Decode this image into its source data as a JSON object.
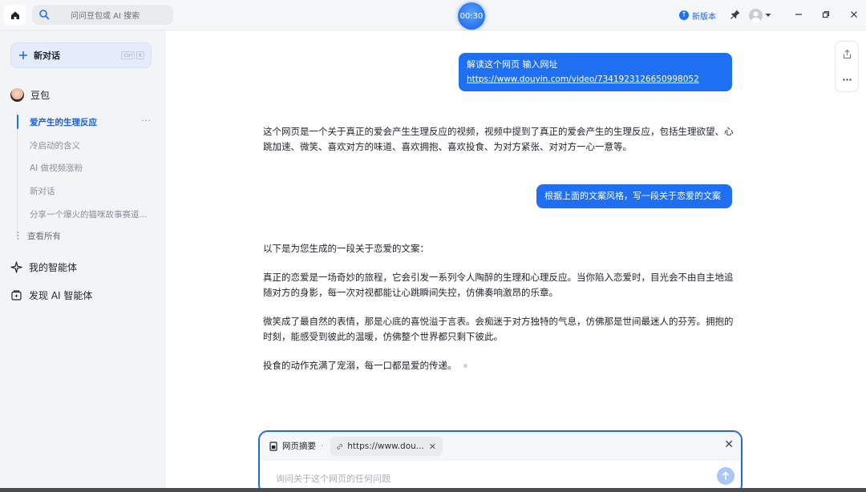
{
  "topbar": {
    "search_placeholder": "问问豆包或 AI 搜索",
    "timer": "00:30",
    "new_version": "新版本"
  },
  "sidebar": {
    "new_chat_label": "新对话",
    "new_chat_shortcut": [
      "Ctrl",
      "K"
    ],
    "bot_name": "豆包",
    "conversations": [
      {
        "label": "爱产生的生理反应",
        "active": true
      },
      {
        "label": "冷启动的含义",
        "active": false
      },
      {
        "label": "AI 做视频涨粉",
        "active": false
      },
      {
        "label": "新对话",
        "active": false
      },
      {
        "label": "分享一个爆火的猫咪故事赛道...",
        "active": false
      }
    ],
    "view_all": "查看所有",
    "my_agents": "我的智能体",
    "discover_agents": "发现 AI 智能体"
  },
  "chat": {
    "user_msg_1_line1": "解读这个网页 输入网址",
    "user_msg_1_link": "https://www.douyin.com/video/7341923126650998052",
    "answer_1": "这个网页是一个关于真正的爱会产生生理反应的视频，视频中提到了真正的爱会产生的生理反应，包括生理欲望、心跳加速、微笑、喜欢对方的味道、喜欢拥抱、喜欢投食、为对方紧张、对对方一心一意等。",
    "user_msg_2": "根据上面的文案风格，写一段关于恋爱的文案",
    "answer_2_intro": "以下是为您生成的一段关于恋爱的文案：",
    "answer_2_p1": "真正的恋爱是一场奇妙的旅程，它会引发一系列令人陶醉的生理和心理反应。当你陷入恋爱时，目光会不由自主地追随对方的身影，每一次对视都能让心跳瞬间失控，仿佛奏响激昂的乐章。",
    "answer_2_p2": "微笑成了最自然的表情，那是心底的喜悦溢于言表。会痴迷于对方独特的气息，仿佛那是世间最迷人的芬芳。拥抱的时刻，能感受到彼此的温暖，仿佛整个世界都只剩下彼此。",
    "answer_2_p3": "投食的动作充满了宠溺，每一口都是爱的传递。"
  },
  "input": {
    "summary_label": "网页摘要",
    "link_chip": "https://www.dou...",
    "placeholder": "询问关于这个网页的任何问题"
  },
  "colors": {
    "accent": "#1e6ff2",
    "sidebar_bg": "#f3f4f6",
    "active_text": "#1d5fd4"
  }
}
